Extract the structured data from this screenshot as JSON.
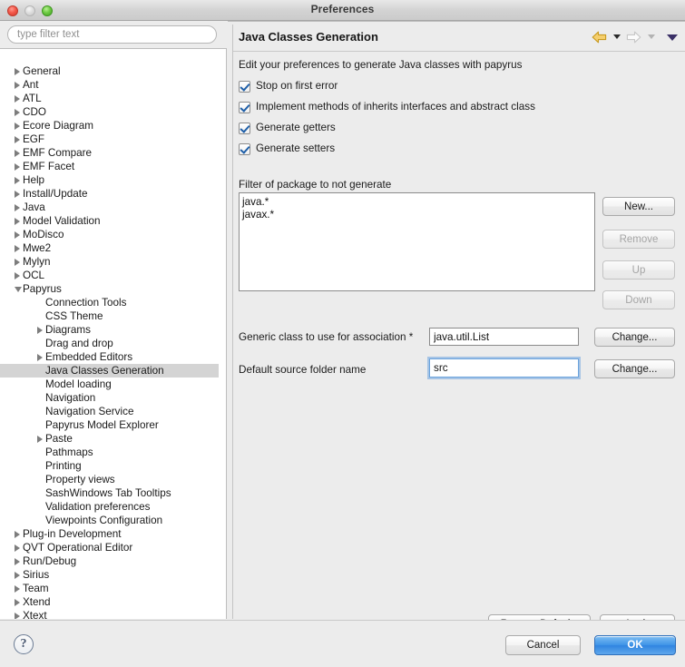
{
  "window": {
    "title": "Preferences",
    "traffic_lights": [
      "close-button",
      "minimize-button",
      "zoom-button"
    ]
  },
  "sidebar": {
    "filter_placeholder": "type filter text",
    "filter_value": "",
    "selected_item": "Java Classes Generation",
    "items": [
      {
        "label": "General",
        "depth": 0,
        "expander": "closed"
      },
      {
        "label": "Ant",
        "depth": 0,
        "expander": "closed"
      },
      {
        "label": "ATL",
        "depth": 0,
        "expander": "closed"
      },
      {
        "label": "CDO",
        "depth": 0,
        "expander": "closed"
      },
      {
        "label": "Ecore Diagram",
        "depth": 0,
        "expander": "closed"
      },
      {
        "label": "EGF",
        "depth": 0,
        "expander": "closed"
      },
      {
        "label": "EMF Compare",
        "depth": 0,
        "expander": "closed"
      },
      {
        "label": "EMF Facet",
        "depth": 0,
        "expander": "closed"
      },
      {
        "label": "Help",
        "depth": 0,
        "expander": "closed"
      },
      {
        "label": "Install/Update",
        "depth": 0,
        "expander": "closed"
      },
      {
        "label": "Java",
        "depth": 0,
        "expander": "closed"
      },
      {
        "label": "Model Validation",
        "depth": 0,
        "expander": "closed"
      },
      {
        "label": "MoDisco",
        "depth": 0,
        "expander": "closed"
      },
      {
        "label": "Mwe2",
        "depth": 0,
        "expander": "closed"
      },
      {
        "label": "Mylyn",
        "depth": 0,
        "expander": "closed"
      },
      {
        "label": "OCL",
        "depth": 0,
        "expander": "closed"
      },
      {
        "label": "Papyrus",
        "depth": 0,
        "expander": "open"
      },
      {
        "label": "Connection Tools",
        "depth": 1,
        "expander": "none"
      },
      {
        "label": "CSS Theme",
        "depth": 1,
        "expander": "none"
      },
      {
        "label": "Diagrams",
        "depth": 1,
        "expander": "closed"
      },
      {
        "label": "Drag and drop",
        "depth": 1,
        "expander": "none"
      },
      {
        "label": "Embedded Editors",
        "depth": 1,
        "expander": "closed"
      },
      {
        "label": "Java Classes Generation",
        "depth": 1,
        "expander": "none",
        "selected": true
      },
      {
        "label": "Model loading",
        "depth": 1,
        "expander": "none"
      },
      {
        "label": "Navigation",
        "depth": 1,
        "expander": "none"
      },
      {
        "label": "Navigation Service",
        "depth": 1,
        "expander": "none"
      },
      {
        "label": "Papyrus Model Explorer",
        "depth": 1,
        "expander": "none"
      },
      {
        "label": "Paste",
        "depth": 1,
        "expander": "closed"
      },
      {
        "label": "Pathmaps",
        "depth": 1,
        "expander": "none"
      },
      {
        "label": "Printing",
        "depth": 1,
        "expander": "none"
      },
      {
        "label": "Property views",
        "depth": 1,
        "expander": "none"
      },
      {
        "label": "SashWindows Tab Tooltips",
        "depth": 1,
        "expander": "none"
      },
      {
        "label": "Validation preferences",
        "depth": 1,
        "expander": "none"
      },
      {
        "label": "Viewpoints Configuration",
        "depth": 1,
        "expander": "none"
      },
      {
        "label": "Plug-in Development",
        "depth": 0,
        "expander": "closed"
      },
      {
        "label": "QVT Operational Editor",
        "depth": 0,
        "expander": "closed"
      },
      {
        "label": "Run/Debug",
        "depth": 0,
        "expander": "closed"
      },
      {
        "label": "Sirius",
        "depth": 0,
        "expander": "closed"
      },
      {
        "label": "Team",
        "depth": 0,
        "expander": "closed"
      },
      {
        "label": "Xtend",
        "depth": 0,
        "expander": "closed"
      },
      {
        "label": "Xtext",
        "depth": 0,
        "expander": "closed"
      }
    ]
  },
  "page": {
    "title": "Java Classes Generation",
    "description": "Edit your preferences to generate Java classes with papyrus",
    "nav": {
      "back_icon": "back-arrow-icon",
      "back_color": "#e8b33c",
      "forward_icon": "forward-arrow-icon",
      "forward_color": "#d8d8d8",
      "menu_icon": "chevron-down-icon",
      "menu_color": "#3a2f66"
    },
    "checkboxes": [
      {
        "label": "Stop on first error",
        "checked": true
      },
      {
        "label": "Implement methods of inherits interfaces and abstract class",
        "checked": true
      },
      {
        "label": "Generate getters",
        "checked": true
      },
      {
        "label": "Generate setters",
        "checked": true
      }
    ],
    "filter_section": {
      "label": "Filter of package to not generate",
      "entries": [
        "java.*",
        "javax.*"
      ],
      "buttons": [
        {
          "label": "New...",
          "enabled": true
        },
        {
          "label": "Remove",
          "enabled": false
        },
        {
          "label": "Up",
          "enabled": false
        },
        {
          "label": "Down",
          "enabled": false
        }
      ]
    },
    "fields": [
      {
        "label": "Generic class to use for association *",
        "value": "java.util.List",
        "button": "Change...",
        "focused": false
      },
      {
        "label": "Default source folder name",
        "value": "src",
        "button": "Change...",
        "focused": true
      }
    ],
    "page_buttons": {
      "restore_defaults": "Restore Defaults",
      "apply": "Apply"
    }
  },
  "footer": {
    "help_icon": "question-mark-icon",
    "help_glyph": "?",
    "cancel": "Cancel",
    "ok": "OK"
  },
  "colors": {
    "accent_blue": "#3e93e8",
    "checkmark_blue": "#1f5fa8",
    "selection_gray": "#d4d4d4",
    "window_bg": "#ececec"
  }
}
